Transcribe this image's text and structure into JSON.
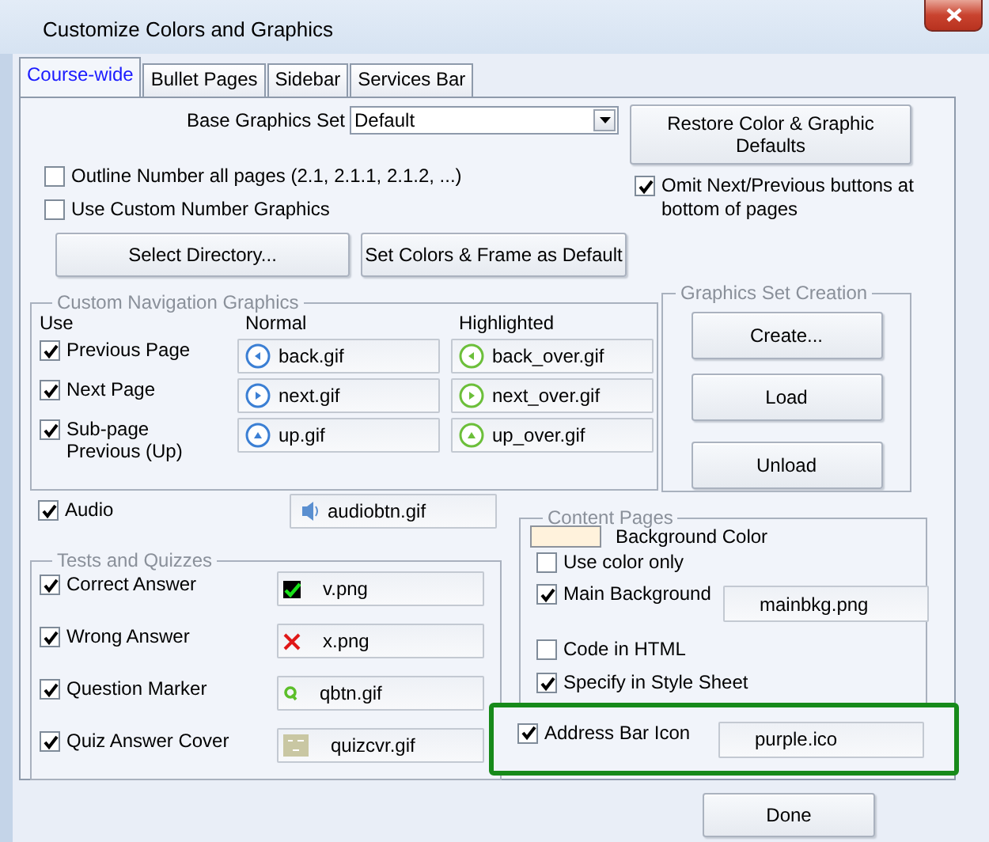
{
  "window": {
    "title": "Customize Colors and Graphics"
  },
  "tabs": [
    {
      "label": "Course-wide",
      "selected": true
    },
    {
      "label": "Bullet Pages",
      "selected": false
    },
    {
      "label": "Sidebar",
      "selected": false
    },
    {
      "label": "Services Bar",
      "selected": false
    }
  ],
  "base_graphics_set": {
    "label": "Base Graphics Set",
    "value": "Default"
  },
  "restore_button": "Restore Color & Graphic Defaults",
  "options": [
    {
      "label": "Outline Number all pages (2.1, 2.1.1, 2.1.2, ...)",
      "checked": false
    },
    {
      "label": "Use Custom Number Graphics",
      "checked": false
    }
  ],
  "omit_nav": {
    "label": "Omit Next/Previous buttons at bottom of pages",
    "checked": true
  },
  "buttons": [
    "Select Directory...",
    "Set Colors & Frame as Default"
  ],
  "navigation": {
    "title": "Custom Navigation Graphics",
    "columns": [
      "Use",
      "Normal",
      "Highlighted"
    ],
    "rows": [
      {
        "label": "Previous Page",
        "checked": true,
        "normal": "back.gif",
        "highlighted": "back_over.gif"
      },
      {
        "label": "Next Page",
        "checked": true,
        "normal": "next.gif",
        "highlighted": "next_over.gif"
      },
      {
        "label": "Sub-page Previous (Up)",
        "checked": true,
        "normal": "up.gif",
        "highlighted": "up_over.gif"
      }
    ]
  },
  "graphics_set": {
    "title": "Graphics Set Creation",
    "buttons": [
      "Create...",
      "Load",
      "Unload"
    ]
  },
  "audio": {
    "label": "Audio",
    "checked": true,
    "file": "audiobtn.gif"
  },
  "tests": {
    "title": "Tests and Quizzes",
    "rows": [
      {
        "label": "Correct Answer",
        "checked": true,
        "file": "v.png"
      },
      {
        "label": "Wrong Answer",
        "checked": true,
        "file": "x.png"
      },
      {
        "label": "Question Marker",
        "checked": true,
        "file": "qbtn.gif"
      },
      {
        "label": "Quiz Answer Cover",
        "checked": true,
        "file": "quizcvr.gif"
      }
    ]
  },
  "content_pages": {
    "title": "Content Pages",
    "background_color": {
      "label": "Background Color",
      "color": "#fff2dc"
    },
    "items": [
      {
        "kind": "checkbox",
        "label": "Use color only",
        "checked": false
      },
      {
        "kind": "file",
        "label": "Main Background",
        "checked": true,
        "file": "mainbkg.png"
      },
      {
        "kind": "checkbox",
        "label": "Code in HTML",
        "checked": false
      },
      {
        "kind": "checkbox",
        "label": "Specify in Style Sheet",
        "checked": true
      }
    ]
  },
  "address_bar": {
    "label": "Address Bar Icon",
    "checked": true,
    "file": "purple.ico",
    "highlighted": true
  },
  "done_button": "Done"
}
